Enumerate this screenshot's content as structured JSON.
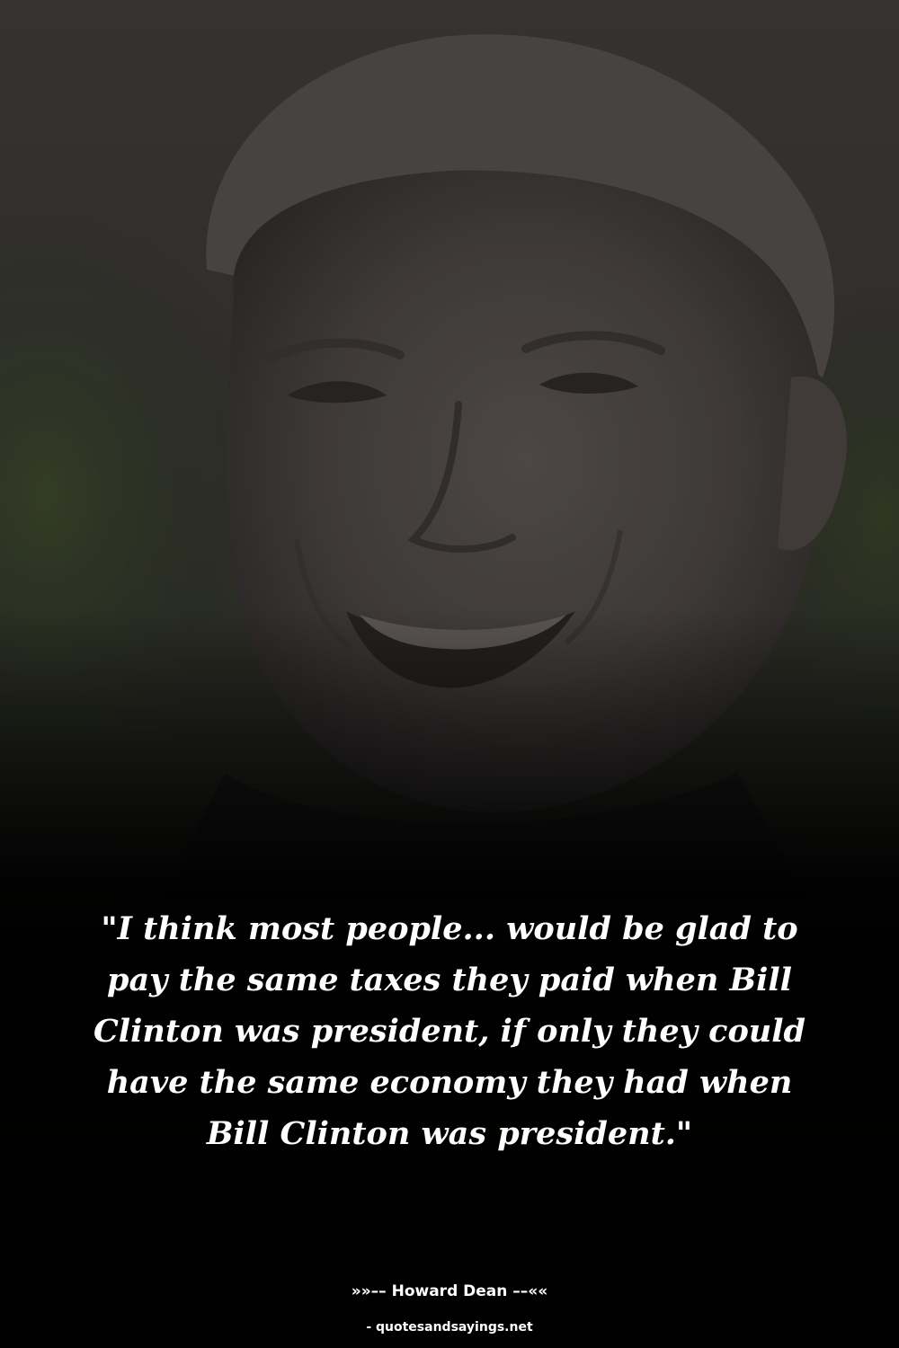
{
  "quote": {
    "text": "\"I think most people... would be glad to pay the same taxes they paid when Bill Clinton was president, if only they could have the same economy they had when Bill Clinton was president.\""
  },
  "attribution": {
    "author_line": "»»–– Howard Dean ––««"
  },
  "watermark": {
    "text": "- quotesandsayings.net"
  },
  "colors": {
    "text": "#ffffff",
    "background_bottom": "#050505",
    "photo_tint": "#3a3836"
  }
}
